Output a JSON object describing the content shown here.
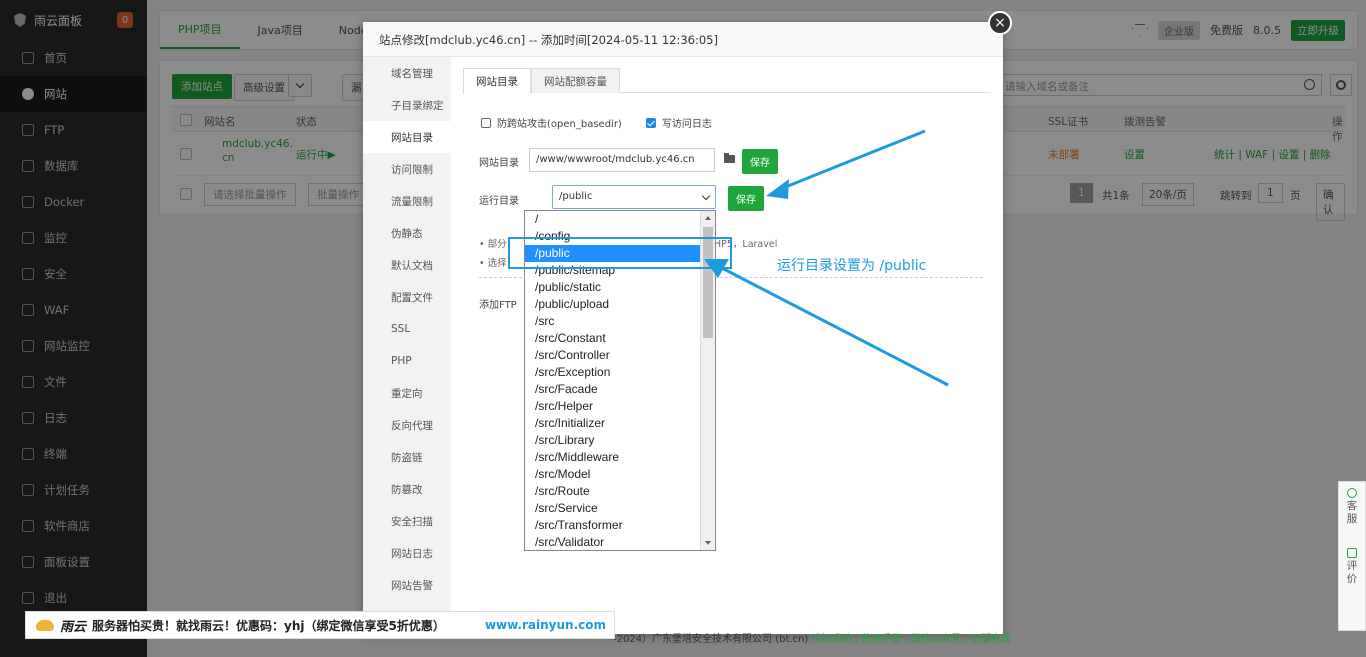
{
  "sidebar": {
    "brand": "雨云面板",
    "badge": "0",
    "items": [
      {
        "label": "首页",
        "icon": "home-icon"
      },
      {
        "label": "网站",
        "icon": "globe-icon"
      },
      {
        "label": "FTP",
        "icon": "ftp-icon"
      },
      {
        "label": "数据库",
        "icon": "database-icon"
      },
      {
        "label": "Docker",
        "icon": "docker-icon"
      },
      {
        "label": "监控",
        "icon": "monitor-icon"
      },
      {
        "label": "安全",
        "icon": "shield-icon"
      },
      {
        "label": "WAF",
        "icon": "waf-icon"
      },
      {
        "label": "网站监控",
        "icon": "chart-icon"
      },
      {
        "label": "文件",
        "icon": "folder-icon"
      },
      {
        "label": "日志",
        "icon": "log-icon"
      },
      {
        "label": "终端",
        "icon": "terminal-icon"
      },
      {
        "label": "计划任务",
        "icon": "calendar-icon"
      },
      {
        "label": "软件商店",
        "icon": "store-icon"
      },
      {
        "label": "面板设置",
        "icon": "settings-icon"
      },
      {
        "label": "退出",
        "icon": "logout-icon"
      }
    ]
  },
  "topbar": {
    "tabs": [
      "PHP项目",
      "Java项目",
      "Node"
    ],
    "edition": "企业版",
    "free_label": "免费版",
    "version": "8.0.5",
    "upgrade": "立即升级"
  },
  "site_list": {
    "add_site": "添加站点",
    "advanced": "高级设置",
    "more": "漏",
    "search_placeholder": "请输入域名或备注",
    "columns": {
      "name": "网站名",
      "status": "状态",
      "ssl": "SSL证书",
      "alert": "拨测告警",
      "ops": "操作"
    },
    "row": {
      "name_line1": "mdclub.yc46.",
      "name_line2": "cn",
      "status": "运行中▶",
      "ssl": "未部署",
      "alert": "设置",
      "ops": "统计 | WAF | 设置 | 删除"
    },
    "batch_placeholder": "请选择批量操作",
    "batch_btn": "批量操作",
    "page": "1",
    "total": "共1条",
    "per_page": "20条/页",
    "jump_label": "跳转到",
    "jump_value": "1",
    "page_unit": "页",
    "confirm": "确认"
  },
  "modal": {
    "title": "站点修改[mdclub.yc46.cn] -- 添加时间[2024-05-11 12:36:05]",
    "close": "×",
    "side_items": [
      "域名管理",
      "子目录绑定",
      "网站目录",
      "访问限制",
      "流量限制",
      "伪静态",
      "默认文档",
      "配置文件",
      "SSL",
      "PHP",
      "重定向",
      "反向代理",
      "防盗链",
      "防篡改",
      "安全扫描",
      "网站日志",
      "网站告警"
    ],
    "tabs": [
      "网站目录",
      "网站配额容量"
    ],
    "opt_cross": "防跨站攻击(open_basedir)",
    "opt_log": "写访问日志",
    "site_dir_label": "网站目录",
    "site_dir_value": "/www/wwwroot/mdclub.yc46.cn",
    "save": "保存",
    "run_dir_label": "运行目录",
    "run_dir_value": "/public",
    "note1_prefix": "部分",
    "note1_suffix": "HP5，Laravel",
    "note2_prefix": "选择",
    "add_ftp": "添加FTP"
  },
  "dropdown": {
    "options": [
      "/",
      "/config",
      "/public",
      "/public/sitemap",
      "/public/static",
      "/public/upload",
      "/src",
      "/src/Constant",
      "/src/Controller",
      "/src/Exception",
      "/src/Facade",
      "/src/Helper",
      "/src/Initializer",
      "/src/Library",
      "/src/Middleware",
      "/src/Model",
      "/src/Route",
      "/src/Service",
      "/src/Transformer",
      "/src/Validator"
    ],
    "selected_index": 2
  },
  "annotation": "运行目录设置为 /public",
  "float_panel": {
    "service": "客服",
    "rate": "评价"
  },
  "ad": {
    "brand": "雨云",
    "text": "服务器怕买贵！就找雨云！优惠码：yhj（绑定微信享受5折优惠）",
    "url": "www.rainyun.com"
  },
  "footer": {
    "text": "-2024）广东堡塔安全技术有限公司 (bt.cn)",
    "links": "论坛求助 | 使用手册 | 微信公众号 | 正版查询"
  },
  "colors": {
    "accent": "#20a53a",
    "annotation": "#1e9be0",
    "sidebar_bg": "#2b2b2b",
    "warn": "#e67e22"
  }
}
